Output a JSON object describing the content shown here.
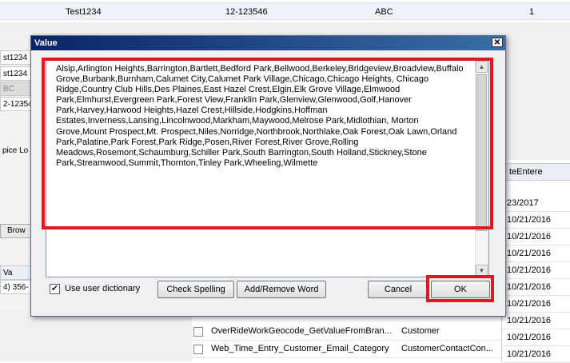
{
  "background": {
    "top_row": {
      "col1": "Test1234",
      "col2": "12-123546",
      "col3": "ABC",
      "col4": "1"
    },
    "left_rows": [
      "st1234",
      "st1234",
      "BC",
      "2-12354",
      "pice Lo"
    ],
    "left_button": "Brow",
    "left_bottom": [
      "Va",
      "4) 356-"
    ],
    "right_grid": {
      "header": "teEntere",
      "dates": [
        "23/2017",
        "10/21/2016",
        "10/21/2016",
        "10/21/2016",
        "10/21/2016",
        "10/21/2016",
        "10/21/2016",
        "10/21/2016",
        "10/21/2016",
        "10/21/2016"
      ]
    },
    "bottom_rows": [
      {
        "name": "OverRideWorkGeocode_GetValueFromBran...",
        "category": "Customer",
        "date": "10/21/2016"
      },
      {
        "name": "Web_Time_Entry_Customer_Email_Category",
        "category": "CustomerContactCon...",
        "date": "10/21/2016"
      }
    ]
  },
  "dialog": {
    "title": "Value",
    "close_glyph": "✕",
    "text": "Alsip,Arlington Heights,Barrington,Bartlett,Bedford Park,Bellwood,Berkeley,Bridgeview,Broadview,Buffalo Grove,Burbank,Burnham,Calumet City,Calumet Park Village,Chicago,Chicago Heights, Chicago Ridge,Country Club Hills,Des Plaines,East Hazel Crest,Elgin,Elk Grove Village,Elmwood Park,Elmhurst,Evergreen Park,Forest View,Franklin Park,Glenview,Glenwood,Golf,Hanover Park,Harvey,Harwood Heights,Hazel Crest,Hillside,Hodgkins,Hoffman Estates,Inverness,Lansing,Lincolnwood,Markham,Maywood,Melrose Park,Midlothian, Morton Grove,Mount Prospect,Mt. Prospect,Niles,Norridge,Northbrook,Northlake,Oak Forest,Oak Lawn,Orland Park,Palatine,Park Forest,Park Ridge,Posen,River Forest,River Grove,Rolling Meadows,Rosemont,Schaumburg,Schiller Park,South Barrington,South Holland,Stickney,Stone Park,Streamwood,Summit,Thornton,Tinley Park,Wheeling,Wilmette",
    "use_user_dictionary_label": "Use user dictionary",
    "use_user_dictionary_checked": "✔",
    "check_spelling_label": "Check Spelling",
    "add_remove_word_label": "Add/Remove Word",
    "cancel_label": "Cancel",
    "ok_label": "OK"
  },
  "colors": {
    "highlight_red": "#e0191f",
    "title_blue": "#0a246a"
  }
}
